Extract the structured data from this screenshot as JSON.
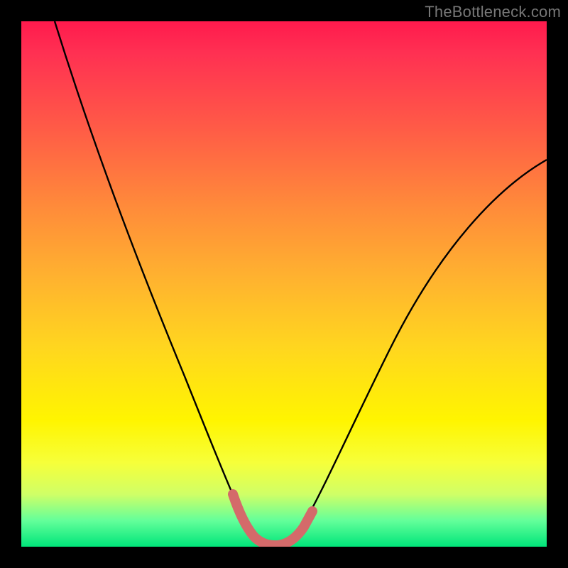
{
  "watermark": "TheBottleneck.com",
  "chart_data": {
    "type": "line",
    "title": "",
    "xlabel": "",
    "ylabel": "",
    "xlim": [
      0,
      100
    ],
    "ylim": [
      0,
      100
    ],
    "series": [
      {
        "name": "black-curve",
        "x": [
          10,
          15,
          20,
          25,
          30,
          35,
          38,
          40,
          42,
          44,
          46,
          48,
          50,
          52,
          55,
          60,
          65,
          70,
          80,
          90,
          100
        ],
        "y": [
          100,
          88,
          77,
          65,
          53,
          39,
          29,
          21,
          13,
          7,
          3,
          1,
          1,
          2,
          5,
          13,
          22,
          31,
          46,
          59,
          70
        ]
      },
      {
        "name": "highlight-band",
        "x": [
          40.5,
          42,
          43,
          44,
          45,
          46,
          47,
          48,
          49,
          50,
          51,
          52,
          53,
          54,
          55.5
        ],
        "y": [
          18,
          13,
          10,
          7,
          5,
          3,
          2,
          1,
          1,
          1,
          1,
          2,
          3,
          5,
          6.5
        ]
      }
    ],
    "colors": {
      "black_curve": "#000000",
      "highlight": "#d46a6a",
      "gradient_top": "#ff1a4d",
      "gradient_mid": "#ffd61f",
      "gradient_bottom": "#00e57a",
      "frame": "#000000"
    }
  }
}
